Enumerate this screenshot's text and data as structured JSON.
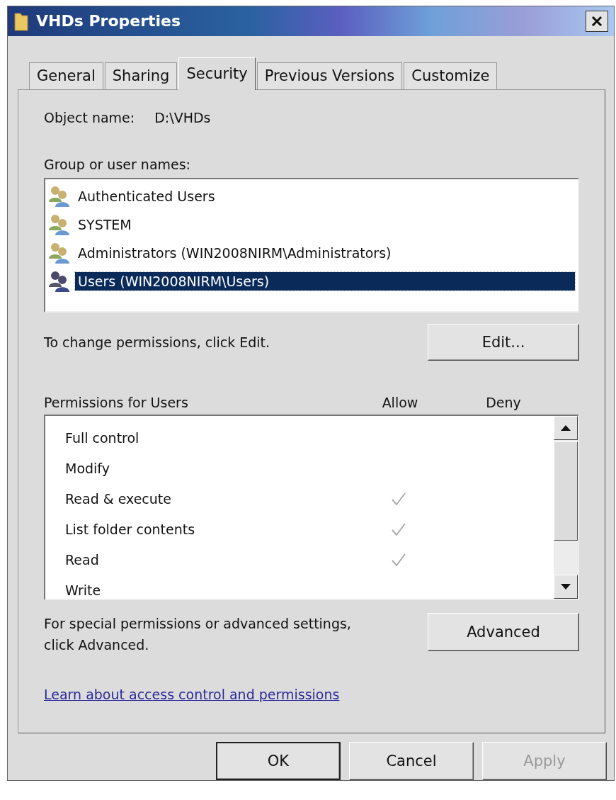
{
  "window": {
    "title": "VHDs Properties"
  },
  "tabs": [
    {
      "label": "General",
      "selected": false
    },
    {
      "label": "Sharing",
      "selected": false
    },
    {
      "label": "Security",
      "selected": true
    },
    {
      "label": "Previous Versions",
      "selected": false
    },
    {
      "label": "Customize",
      "selected": false
    }
  ],
  "object_name": {
    "label": "Object name:",
    "value": "D:\\VHDs"
  },
  "groups": {
    "label": "Group or user names:",
    "items": [
      {
        "name": "Authenticated Users",
        "selected": false
      },
      {
        "name": "SYSTEM",
        "selected": false
      },
      {
        "name": "Administrators (WIN2008NIRM\\Administrators)",
        "selected": false
      },
      {
        "name": "Users (WIN2008NIRM\\Users)",
        "selected": true
      }
    ]
  },
  "change_hint": "To change permissions, click Edit.",
  "edit_button": "Edit...",
  "permissions": {
    "label": "Permissions for Users",
    "columns": [
      "Allow",
      "Deny"
    ],
    "rows": [
      {
        "name": "Full control",
        "allow": false,
        "deny": false
      },
      {
        "name": "Modify",
        "allow": false,
        "deny": false
      },
      {
        "name": "Read & execute",
        "allow": true,
        "deny": false
      },
      {
        "name": "List folder contents",
        "allow": true,
        "deny": false
      },
      {
        "name": "Read",
        "allow": true,
        "deny": false
      },
      {
        "name": "Write",
        "allow": false,
        "deny": false
      }
    ]
  },
  "advanced_hint": "For special permissions or advanced settings, click Advanced.",
  "advanced_button": "Advanced",
  "link": "Learn about access control and permissions",
  "buttons": [
    {
      "label": "OK",
      "default": true,
      "disabled": false
    },
    {
      "label": "Cancel",
      "default": false,
      "disabled": false
    },
    {
      "label": "Apply",
      "default": false,
      "disabled": true
    }
  ]
}
